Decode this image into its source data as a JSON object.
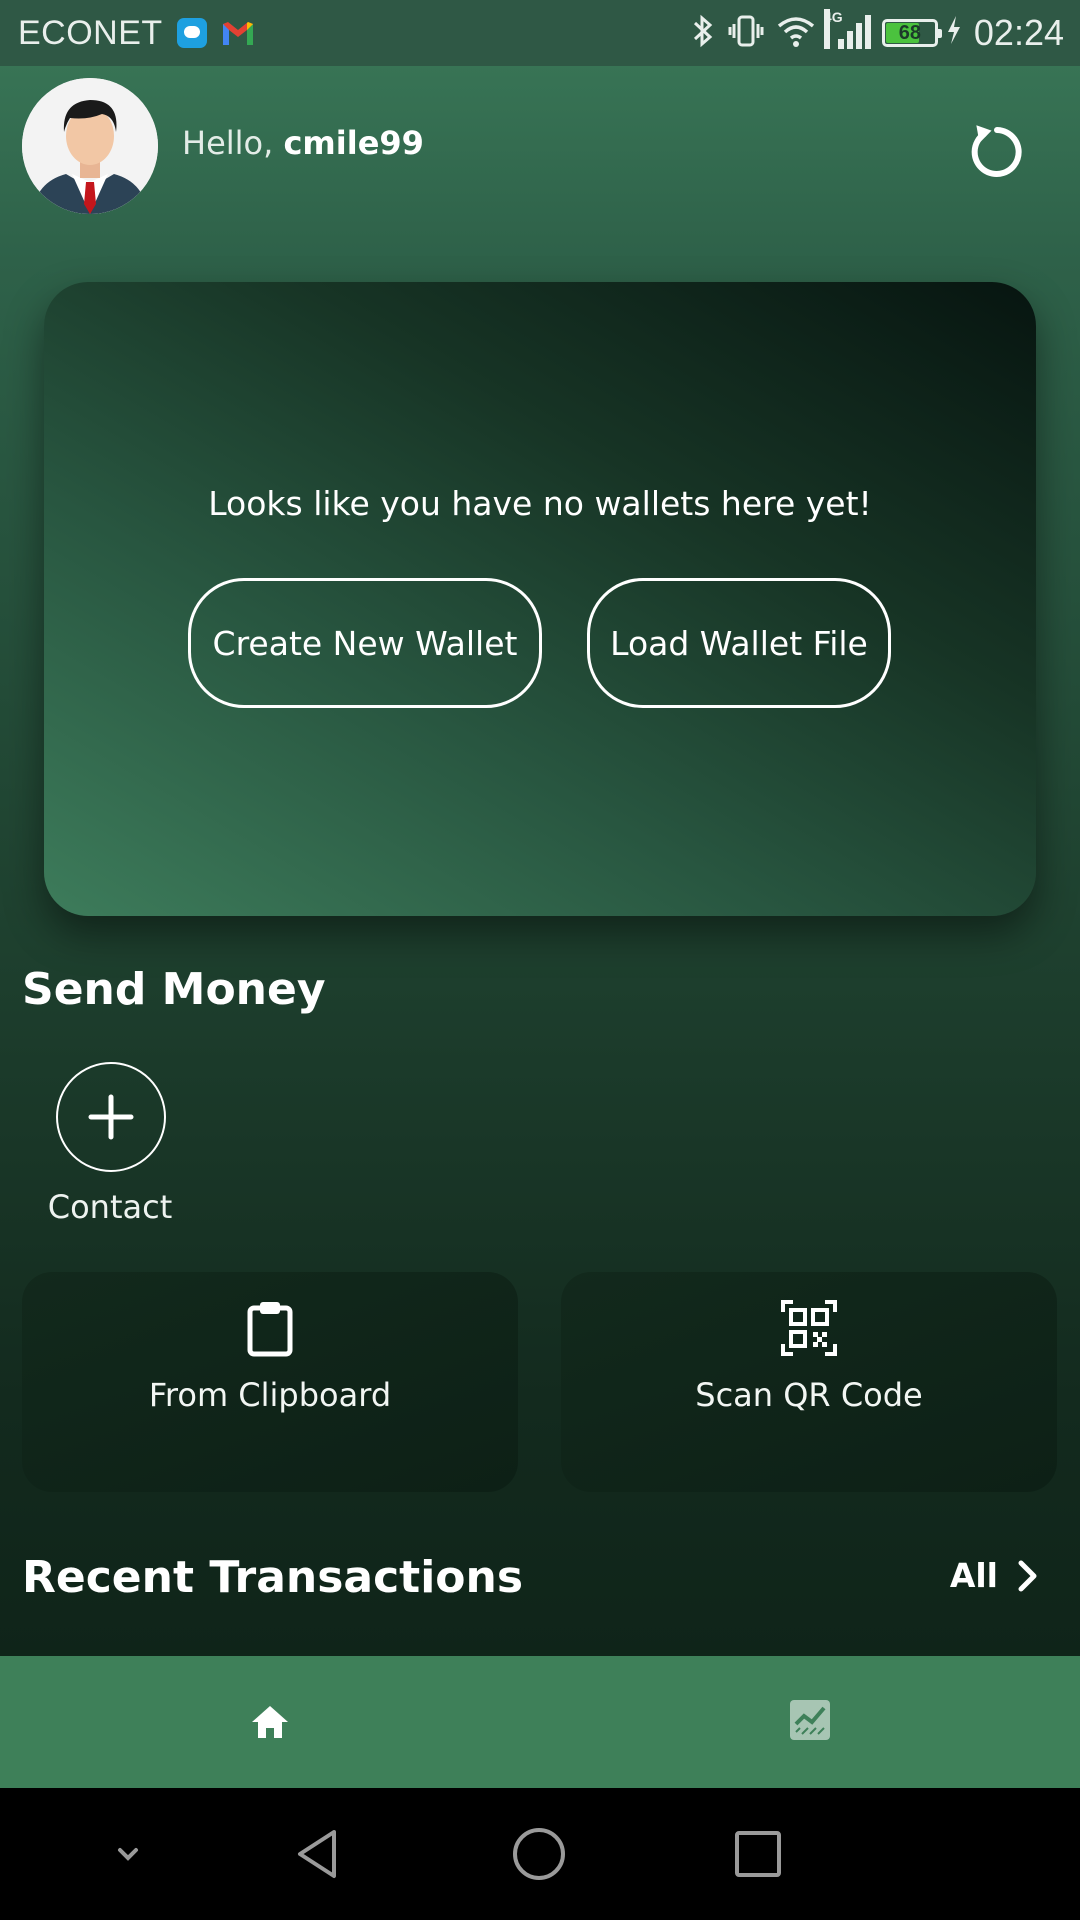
{
  "status_bar": {
    "carrier": "ECONET",
    "network": "4G",
    "battery": "68",
    "time": "02:24"
  },
  "header": {
    "greeting": "Hello,",
    "username": "cmile99"
  },
  "wallet_card": {
    "message": "Looks like you have no wallets here yet!",
    "create_label": "Create New Wallet",
    "load_label": "Load Wallet File"
  },
  "send_money": {
    "title": "Send Money",
    "contact_label": "Contact",
    "clipboard_label": "From Clipboard",
    "qr_label": "Scan QR Code"
  },
  "recent": {
    "title": "Recent Transactions",
    "all_label": "All"
  },
  "bottom_nav": {
    "items": [
      {
        "icon": "home-icon",
        "active": true
      },
      {
        "icon": "chart-icon",
        "active": false
      }
    ]
  },
  "colors": {
    "accent": "#3e8059",
    "card_dark": "#071510",
    "statusbar": "#2f5845"
  }
}
